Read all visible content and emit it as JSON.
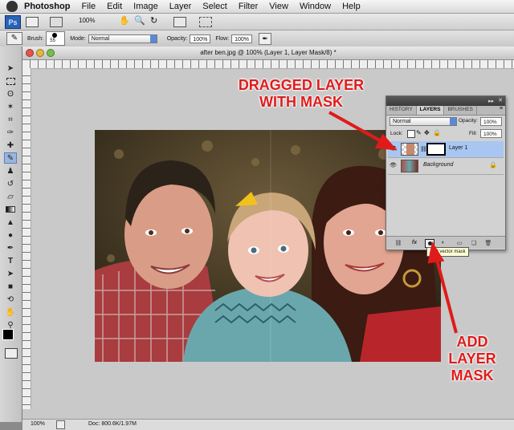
{
  "menubar": {
    "app_name": "Photoshop",
    "items": [
      "File",
      "Edit",
      "Image",
      "Layer",
      "Select",
      "Filter",
      "View",
      "Window",
      "Help"
    ]
  },
  "appbar": {
    "ps_badge": "Ps",
    "zoom": "100%"
  },
  "options": {
    "brush_label": "Brush:",
    "brush_size": "55",
    "mode_label": "Mode:",
    "mode_value": "Normal",
    "opacity_label": "Opacity:",
    "opacity_value": "100%",
    "flow_label": "Flow:",
    "flow_value": "100%"
  },
  "document": {
    "title": "after ben.jpg @ 100% (Layer 1, Layer Mask/8) *",
    "zoom": "100%",
    "doc_info": "Doc: 800.6K/1.97M"
  },
  "layers_panel": {
    "tabs": [
      "HISTORY",
      "LAYERS",
      "BRUSHES"
    ],
    "active_tab": "LAYERS",
    "blend_mode": "Normal",
    "opacity_label": "Opacity:",
    "opacity_value": "100%",
    "lock_label": "Lock:",
    "fill_label": "Fill:",
    "fill_value": "100%",
    "layers": [
      {
        "name": "Layer 1",
        "selected": true
      },
      {
        "name": "Background",
        "selected": false
      }
    ],
    "tooltip": "Add vector mask"
  },
  "annotations": {
    "dragged_line1": "DRAGGED LAYER",
    "dragged_line2": "WITH MASK",
    "add_line1": "ADD",
    "add_line2": "LAYER",
    "add_line3": "MASK"
  },
  "colors": {
    "accent": "#e01b1b",
    "selection": "#a9c6f2",
    "ps_blue": "#2a62b8"
  }
}
